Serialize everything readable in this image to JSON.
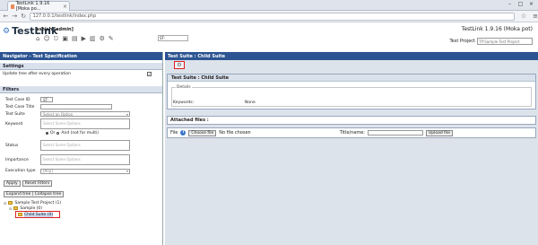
{
  "browser": {
    "tab_title": "TestLink 1.9.16 [Moka po..."
  },
  "app": {
    "logo_text": "TestLink",
    "user_label": "ashish [admin]",
    "version": "TestLink 1.9.16 (Moka pot)",
    "project_label": "Test Project",
    "project_value": "TP:Sample Test Project"
  },
  "left": {
    "title": "Navigator - Test Specification",
    "settings": {
      "header": "Settings",
      "update_tree_label": "Update tree after every operation"
    },
    "filters": {
      "header": "Filters",
      "fields": {
        "tc_id_label": "Test Case ID",
        "tc_id_value": "ST-",
        "tc_title_label": "Test Case Title",
        "suite_label": "Test Suite",
        "suite_value": "Select an Option",
        "keyword_label": "Keyword",
        "keyword_placeholder": "Select Some Options",
        "or_label": "Or",
        "and_label": "And (not for multi)",
        "status_label": "Status",
        "status_placeholder": "Select Some Options",
        "importance_label": "Importance",
        "importance_placeholder": "Select Some Options",
        "exec_type_label": "Execution type",
        "exec_type_value": "[Any]"
      },
      "apply_button": "Apply",
      "reset_button": "Reset Filters"
    },
    "tree_controls": "Expand tree | Collapse tree",
    "tree": {
      "root": "Sample Test Project (1)",
      "child": "Sample (0)",
      "leaf": "Child Suite (0)"
    }
  },
  "right": {
    "title": "Test Suite : Child Suite",
    "panel_title": "Test Suite : Child Suite",
    "details_legend": "Details",
    "keywords_label": "Keywords:",
    "keywords_value": "None",
    "attached_files_label": "Attached files :",
    "file_label": "File",
    "choose_file_button": "Choose file",
    "no_file_text": "No file chosen",
    "title_label": "Title/name:",
    "upload_button": "Upload file"
  },
  "colors": {
    "nav_bar": "#2c5492",
    "highlight": "#e02020"
  }
}
